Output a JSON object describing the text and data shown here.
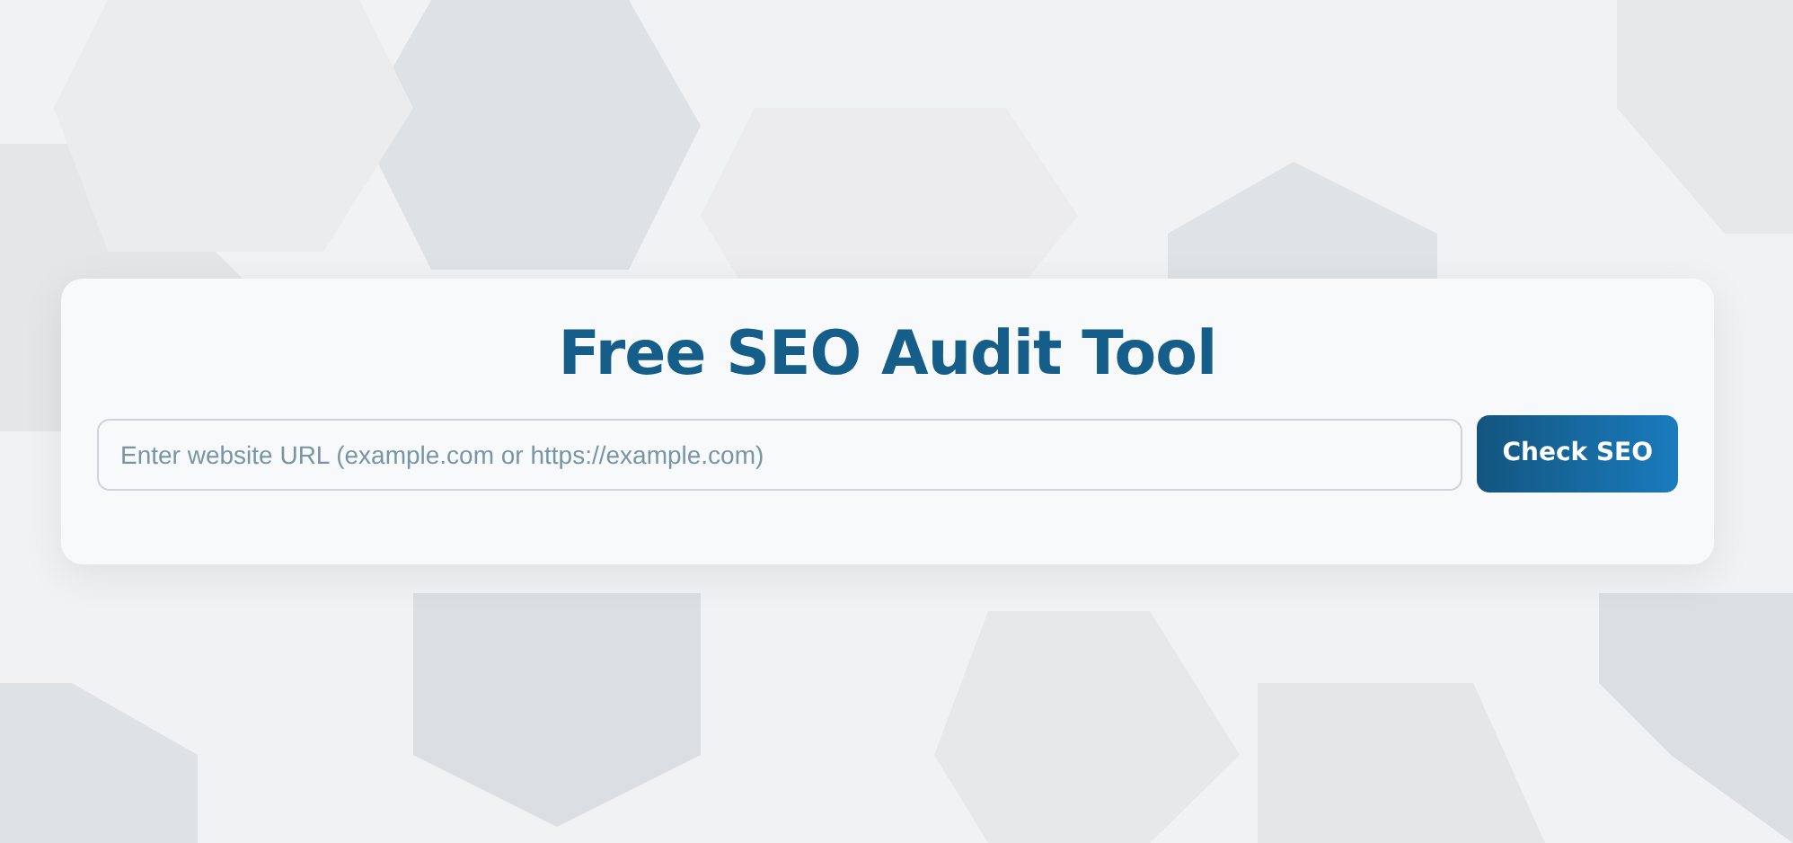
{
  "audit_form": {
    "title": "Free SEO Audit Tool",
    "url_field": {
      "placeholder": "Enter website URL (example.com or https://example.com)"
    },
    "submit_button": "Check SEO"
  }
}
